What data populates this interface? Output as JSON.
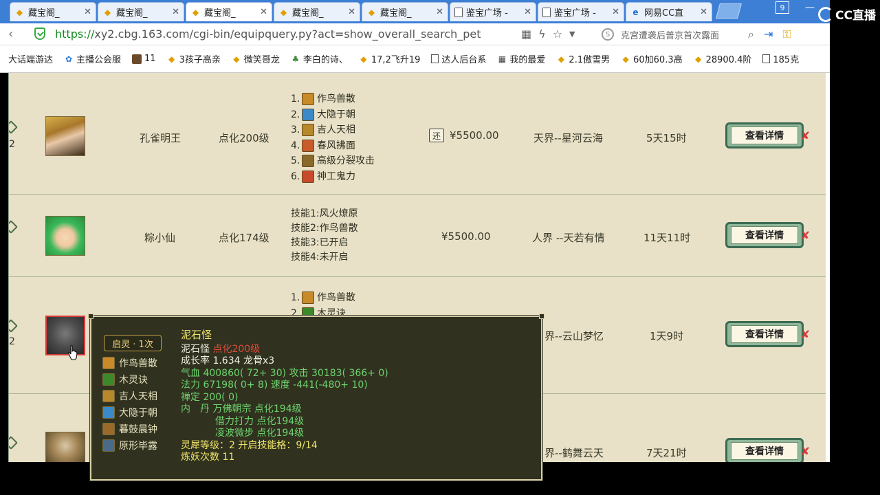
{
  "browser": {
    "tabs": [
      {
        "label": "藏宝阁_",
        "icon": "gold-ingot-icon",
        "active": false
      },
      {
        "label": "藏宝阁_",
        "icon": "gold-ingot-icon",
        "active": false
      },
      {
        "label": "藏宝阁_",
        "icon": "gold-ingot-icon",
        "active": true
      },
      {
        "label": "藏宝阁_",
        "icon": "gold-ingot-icon",
        "active": false
      },
      {
        "label": "藏宝阁_",
        "icon": "gold-ingot-icon",
        "active": false
      },
      {
        "label": "鉴宝广场 -",
        "icon": "document-icon",
        "active": false
      },
      {
        "label": "鉴宝广场 -",
        "icon": "document-icon",
        "active": false
      },
      {
        "label": "网易CC直",
        "icon": "ie-icon",
        "active": false
      }
    ],
    "close_glyph": "✕",
    "window_badge": "9",
    "url_scheme": "https://",
    "url_rest": "xy2.cbg.163.com/cgi-bin/equipquery.py?act=show_overall_search_pet",
    "search_placeholder": "克宫遭袭后普京首次露面",
    "bookmarks": [
      {
        "label": "大话端游达",
        "icon": "none"
      },
      {
        "label": "主播公会服",
        "icon": "paw-icon"
      },
      {
        "label": "11",
        "icon": "image-icon"
      },
      {
        "label": "3孩子高亲",
        "icon": "gold-ingot-icon"
      },
      {
        "label": "微笑哥龙",
        "icon": "gold-ingot-icon"
      },
      {
        "label": "李白的诗、",
        "icon": "plant-icon"
      },
      {
        "label": "17,2飞升19",
        "icon": "gold-ingot-icon"
      },
      {
        "label": "达人后台系",
        "icon": "document-icon"
      },
      {
        "label": "我的最爱",
        "icon": "grid-icon"
      },
      {
        "label": "2.1傲雪男",
        "icon": "gold-ingot-icon"
      },
      {
        "label": "60加60.3高",
        "icon": "gold-ingot-icon"
      },
      {
        "label": "28900.4阶",
        "icon": "gold-ingot-icon"
      },
      {
        "label": "185克",
        "icon": "document-icon"
      }
    ]
  },
  "overlay_logo": "CC直播",
  "listings": [
    {
      "star_num": "2",
      "name": "孔雀明王",
      "level": "点化200级",
      "skills": [
        {
          "num": "1.",
          "name": "作鸟兽散",
          "color": "#c98a2a"
        },
        {
          "num": "2.",
          "name": "大隐于朝",
          "color": "#3a8ac9"
        },
        {
          "num": "3.",
          "name": "吉人天相",
          "color": "#b8892a"
        },
        {
          "num": "4.",
          "name": "春风拂面",
          "color": "#c95a2a"
        },
        {
          "num": "5.",
          "name": "高级分裂攻击",
          "color": "#8a6a2a"
        },
        {
          "num": "6.",
          "name": "神工鬼力",
          "color": "#c94a2a"
        }
      ],
      "return_badge": "还",
      "price": "¥5500.00",
      "server": "天界--星河云海",
      "time": "5天15时",
      "button": "查看详情"
    },
    {
      "star_num": "",
      "name": "粽小仙",
      "level": "点化174级",
      "skill_lines": [
        "技能1:风火燎原",
        "技能2:作鸟兽散",
        "技能3:已开启",
        "技能4:未开启"
      ],
      "price": "¥5500.00",
      "server": "人界 --天若有情",
      "time": "11天11时",
      "button": "查看详情"
    },
    {
      "star_num": "2",
      "skills": [
        {
          "num": "1.",
          "name": "作鸟兽散",
          "color": "#c98a2a"
        },
        {
          "num": "2.",
          "name": "木灵诀",
          "color": "#3a8a2a"
        }
      ],
      "server": "界--云山梦忆",
      "time": "1天9时",
      "button": "查看详情"
    },
    {
      "star_num": "",
      "server": "界--鹤舞云天",
      "time": "7天21时",
      "button": "查看详情"
    }
  ],
  "popup": {
    "badge": "启灵 · 1次",
    "skills": [
      {
        "name": "作鸟兽散",
        "color": "#c98a2a"
      },
      {
        "name": "木灵诀",
        "color": "#3a8a2a"
      },
      {
        "name": "吉人天相",
        "color": "#b8892a"
      },
      {
        "name": "大隐于朝",
        "color": "#3a8ac9"
      },
      {
        "name": "暮鼓晨钟",
        "color": "#9a6a2a"
      },
      {
        "name": "原形毕露",
        "color": "#4a6a8a"
      }
    ],
    "title": "泥石怪",
    "line1_name": "泥石怪",
    "line1_level": "点化200级",
    "line2": "成长率 1.634 龙骨x3",
    "hp_label": "气血",
    "hp_value": "400860( 72+ 30)",
    "atk_label": "攻击",
    "atk_value": "30183( 366+ 0)",
    "mp_label": "法力",
    "mp_value": "67198( 0+ 8)",
    "spd_label": "速度",
    "spd_value": "-441(-480+ 10)",
    "zen_label": "禅定",
    "zen_value": "200( 0)",
    "neidan_label": "内　丹",
    "neidan": [
      "万佛朝宗 点化194级",
      "借力打力 点化194级",
      "凌波微步 点化194级"
    ],
    "spirit_line": "灵犀等级：2 开启技能格：9/14",
    "refine_line": "炼妖次数 11"
  },
  "colors": {
    "content_bg": "#e8e1c7",
    "popup_bg": "#30321f",
    "green_text": "#6ed36e",
    "red_text": "#e04a3a",
    "yellow_text": "#f0e46a"
  }
}
